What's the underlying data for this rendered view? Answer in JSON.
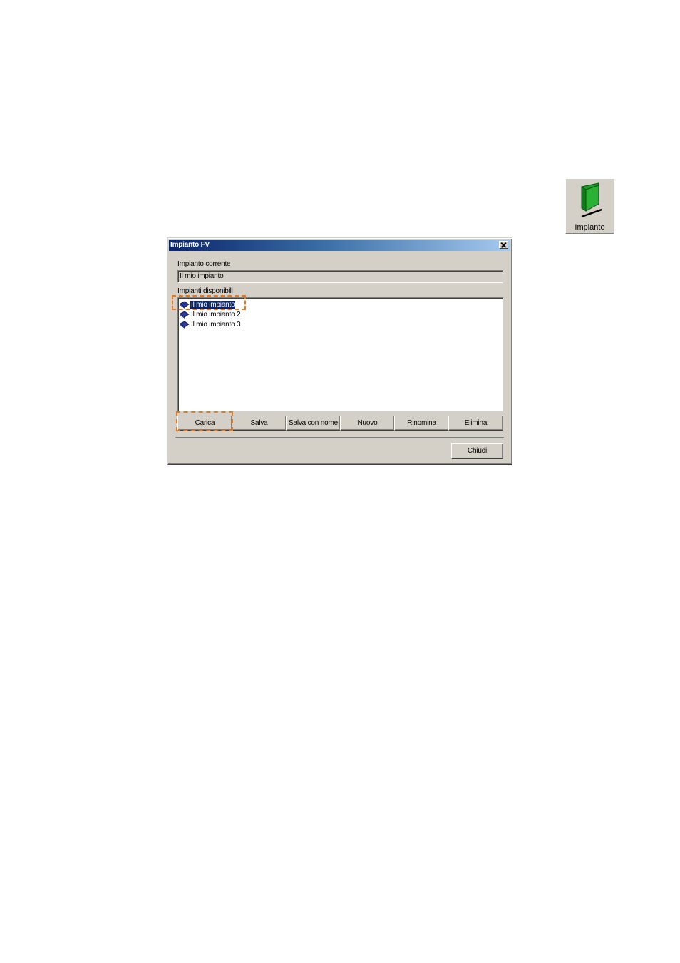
{
  "toolbar_tile": {
    "label": "Impianto",
    "icon": "green-folder-icon",
    "icon_color": "#1f9e2a"
  },
  "dialog": {
    "title": "Impianto FV",
    "current_label": "Impianto corrente",
    "current_value": "Il mio impianto",
    "available_label": "Impianti disponibili",
    "items": [
      {
        "label": "Il mio impianto",
        "selected": true
      },
      {
        "label": "Il mio impianto 2",
        "selected": false
      },
      {
        "label": "Il mio impianto 3",
        "selected": false
      }
    ],
    "buttons": {
      "load": "Carica",
      "save": "Salva",
      "save_as": "Salva con nome",
      "new": "Nuovo",
      "rename": "Rinomina",
      "delete": "Elimina"
    },
    "close": "Chiudi"
  },
  "colors": {
    "highlight": "#0a246a",
    "callout": "#e87722",
    "face": "#d4d0c8"
  }
}
